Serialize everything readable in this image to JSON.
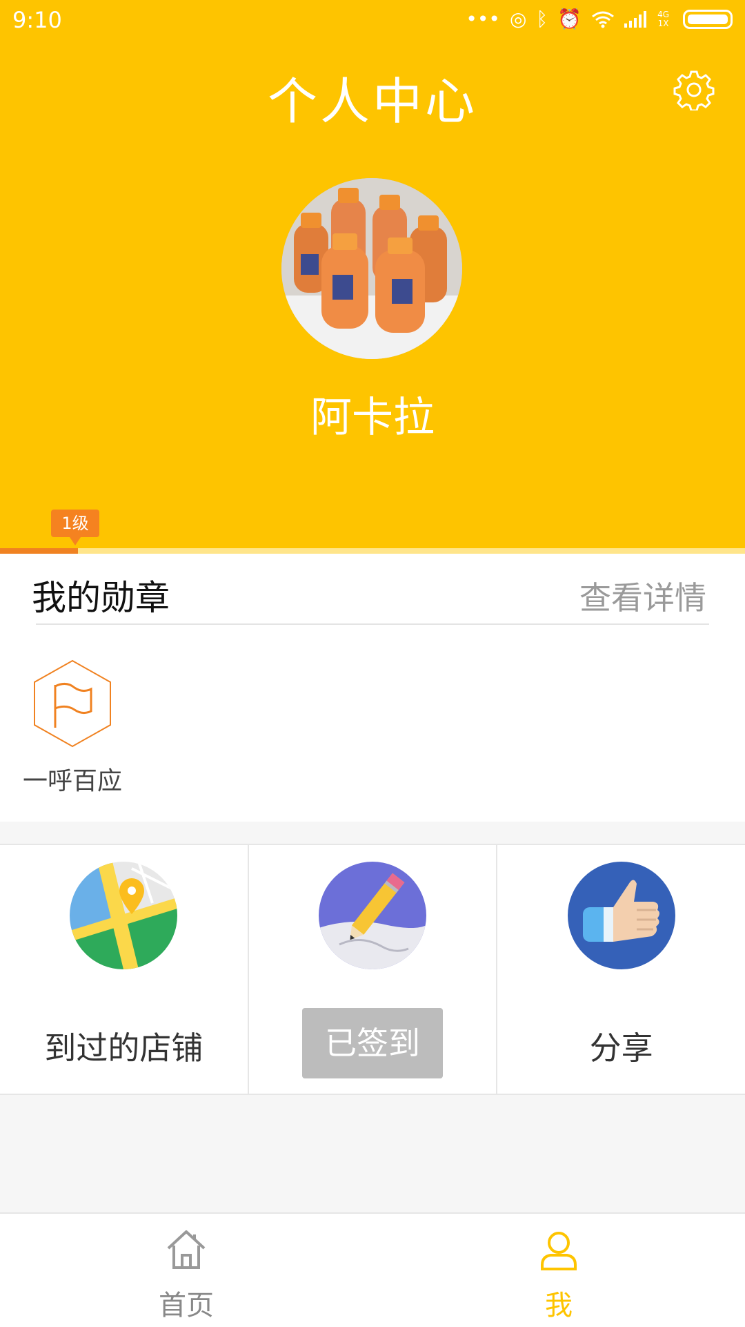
{
  "status_bar": {
    "time": "9:10",
    "network_top": "4G",
    "network_bottom": "1X",
    "icons": [
      "dots-icon",
      "hotspot-icon",
      "bluetooth-icon",
      "alarm-icon",
      "wifi-icon",
      "signal-icon",
      "battery-icon"
    ]
  },
  "header": {
    "title": "个人中心",
    "settings_icon": "gear-icon",
    "username": "阿卡拉",
    "level": "1级",
    "level_progress": 0.105,
    "background_color": "#FEC400",
    "progress_color": "#F08221"
  },
  "medals": {
    "title": "我的勋章",
    "detail_link": "查看详情",
    "items": [
      {
        "label": "一呼百应",
        "icon": "flag-hexagon-icon"
      }
    ]
  },
  "actions": [
    {
      "label": "到过的店铺",
      "icon": "map-pin-icon"
    },
    {
      "label": "已签到",
      "icon": "pencil-icon",
      "state": "disabled"
    },
    {
      "label": "分享",
      "icon": "thumbs-up-icon"
    }
  ],
  "tabbar": {
    "tabs": [
      {
        "label": "首页",
        "icon": "home-icon",
        "active": false
      },
      {
        "label": "我",
        "icon": "user-icon",
        "active": true
      }
    ],
    "active_color": "#FEC400"
  }
}
